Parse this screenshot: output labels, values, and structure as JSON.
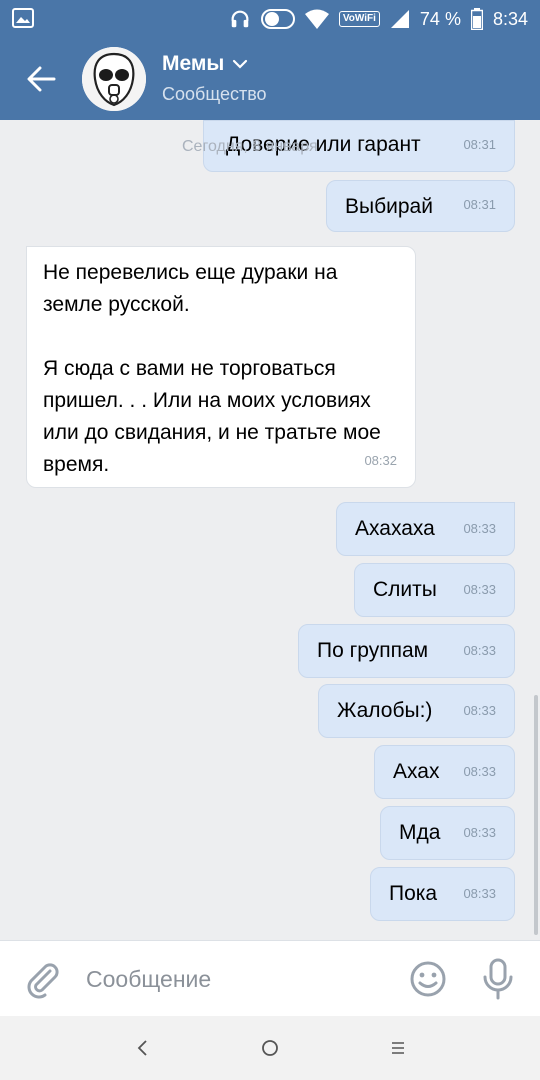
{
  "status_bar": {
    "battery": "74 %",
    "time": "8:34",
    "volte": "VoWiFi"
  },
  "header": {
    "title": "Мемы",
    "subtitle": "Сообщество"
  },
  "chat": {
    "date_overlay": "Сегодня, 8 января",
    "messages": [
      {
        "dir": "out",
        "text": "Доверие или гарант",
        "time": "08:31"
      },
      {
        "dir": "out",
        "text": "Выбирай",
        "time": "08:31"
      },
      {
        "dir": "in",
        "paragraphs": [
          "Не перевелись еще дураки на земле русской.",
          "Я сюда с вами не торговаться пришел. . . Или на моих условиях или до свидания, и не тратьте мое время."
        ],
        "time": "08:32"
      },
      {
        "dir": "out",
        "text": "Ахахаха",
        "time": "08:33"
      },
      {
        "dir": "out",
        "text": "Слиты",
        "time": "08:33"
      },
      {
        "dir": "out",
        "text": "По группам",
        "time": "08:33"
      },
      {
        "dir": "out",
        "text": "Жалобы:)",
        "time": "08:33"
      },
      {
        "dir": "out",
        "text": "Ахах",
        "time": "08:33"
      },
      {
        "dir": "out",
        "text": "Мда",
        "time": "08:33"
      },
      {
        "dir": "out",
        "text": "Пока",
        "time": "08:33"
      }
    ]
  },
  "input": {
    "placeholder": "Сообщение"
  },
  "icons": {
    "back": "arrow-left-icon",
    "dropdown": "chevron-down-icon",
    "attach": "paperclip-icon",
    "emoji": "smiley-icon",
    "mic": "microphone-icon",
    "nav_back": "nav-back-icon",
    "nav_home": "nav-home-icon",
    "nav_menu": "nav-menu-icon"
  },
  "colors": {
    "accent": "#4a76a8",
    "outgoing_bubble": "#dae7f8",
    "incoming_bubble": "#ffffff",
    "background": "#edeef0"
  }
}
